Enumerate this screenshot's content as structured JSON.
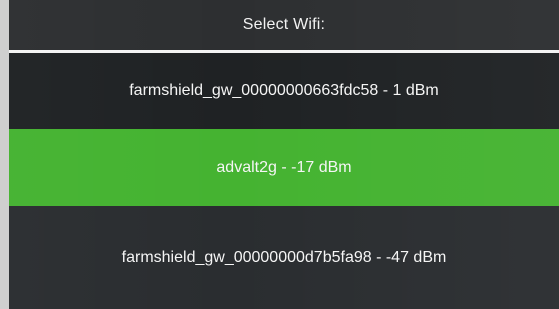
{
  "header": {
    "title": "Select Wifi:"
  },
  "networks": [
    {
      "label": "farmshield_gw_00000000663fdc58 - 1 dBm"
    },
    {
      "label": "advalt2g - -17 dBm"
    },
    {
      "label": "farmshield_gw_00000000d7b5fa98 - -47 dBm"
    }
  ],
  "colors": {
    "selected_background": "#45b331",
    "background": "#262829",
    "text": "#f5f5f5"
  }
}
